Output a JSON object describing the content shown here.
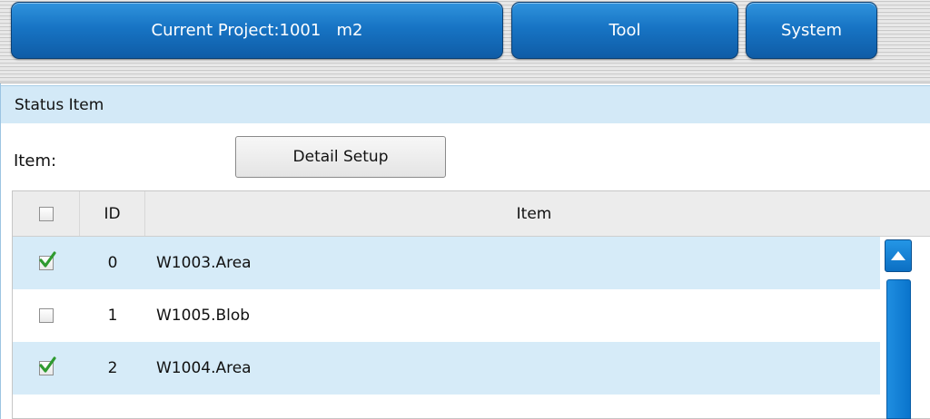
{
  "topbar": {
    "project_label": "Current Project:1001   m2",
    "tool_label": "Tool",
    "system_label": "System"
  },
  "section": {
    "title": "Status Item"
  },
  "form": {
    "item_label": "Item:",
    "detail_button_label": "Detail Setup"
  },
  "table": {
    "headers": {
      "id": "ID",
      "item": "Item"
    },
    "rows": [
      {
        "checked": true,
        "id": "0",
        "item": "W1003.Area"
      },
      {
        "checked": false,
        "id": "1",
        "item": "W1005.Blob"
      },
      {
        "checked": true,
        "id": "2",
        "item": "W1004.Area"
      }
    ]
  },
  "colors": {
    "accent_blue": "#1774c4",
    "row_highlight": "#d6ebf8",
    "check_green": "#2f9a2f"
  },
  "icons": {
    "scroll_up": "triangle-up-icon",
    "check": "checkmark-icon"
  }
}
